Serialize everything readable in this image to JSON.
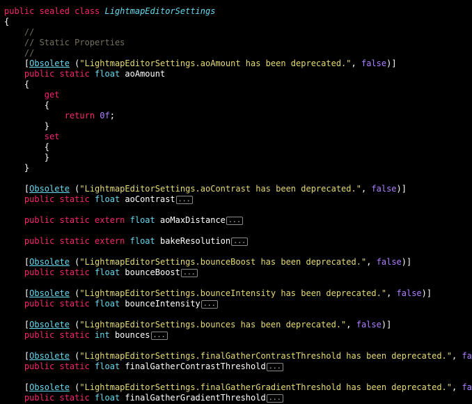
{
  "colors": {
    "background": "#000000",
    "keyword": "#f92672",
    "type": "#66d9ef",
    "string": "#e6db74",
    "number": "#ae81ff",
    "comment": "#75715e",
    "plain": "#ffffff"
  },
  "lines": [
    {
      "tokens": [
        [
          "kw",
          "public sealed class "
        ],
        [
          "ty-i",
          "LightmapEditorSettings"
        ]
      ]
    },
    {
      "tokens": [
        [
          "plain",
          "{"
        ]
      ]
    },
    {
      "tokens": [
        [
          "cm",
          "    //"
        ]
      ]
    },
    {
      "tokens": [
        [
          "cm",
          "    // Static Properties"
        ]
      ]
    },
    {
      "tokens": [
        [
          "cm",
          "    //"
        ]
      ]
    },
    {
      "tokens": [
        [
          "plain",
          "    ["
        ],
        [
          "attr",
          "Obsolete"
        ],
        [
          "plain",
          " ("
        ],
        [
          "str",
          "\"LightmapEditorSettings.aoAmount has been deprecated.\""
        ],
        [
          "plain",
          ", "
        ],
        [
          "num",
          "false"
        ],
        [
          "plain",
          ")]"
        ]
      ]
    },
    {
      "tokens": [
        [
          "kw",
          "    public static "
        ],
        [
          "ty",
          "float"
        ],
        [
          "plain",
          " aoAmount"
        ]
      ]
    },
    {
      "tokens": [
        [
          "plain",
          "    {"
        ]
      ]
    },
    {
      "tokens": [
        [
          "kw",
          "        get"
        ]
      ]
    },
    {
      "tokens": [
        [
          "plain",
          "        {"
        ]
      ]
    },
    {
      "tokens": [
        [
          "kw",
          "            return "
        ],
        [
          "num",
          "0f"
        ],
        [
          "plain",
          ";"
        ]
      ]
    },
    {
      "tokens": [
        [
          "plain",
          "        }"
        ]
      ]
    },
    {
      "tokens": [
        [
          "kw",
          "        set"
        ]
      ]
    },
    {
      "tokens": [
        [
          "plain",
          "        {"
        ]
      ]
    },
    {
      "tokens": [
        [
          "plain",
          "        }"
        ]
      ]
    },
    {
      "tokens": [
        [
          "plain",
          "    }"
        ]
      ]
    },
    {
      "tokens": []
    },
    {
      "tokens": [
        [
          "plain",
          "    ["
        ],
        [
          "attr",
          "Obsolete"
        ],
        [
          "plain",
          " ("
        ],
        [
          "str",
          "\"LightmapEditorSettings.aoContrast has been deprecated.\""
        ],
        [
          "plain",
          ", "
        ],
        [
          "num",
          "false"
        ],
        [
          "plain",
          ")]"
        ]
      ]
    },
    {
      "tokens": [
        [
          "kw",
          "    public static "
        ],
        [
          "ty",
          "float"
        ],
        [
          "plain",
          " aoContrast"
        ],
        [
          "fold",
          "..."
        ]
      ]
    },
    {
      "tokens": []
    },
    {
      "tokens": [
        [
          "kw",
          "    public static extern "
        ],
        [
          "ty",
          "float"
        ],
        [
          "plain",
          " aoMaxDistance"
        ],
        [
          "fold",
          "..."
        ]
      ]
    },
    {
      "tokens": []
    },
    {
      "tokens": [
        [
          "kw",
          "    public static extern "
        ],
        [
          "ty",
          "float"
        ],
        [
          "plain",
          " bakeResolution"
        ],
        [
          "fold",
          "..."
        ]
      ]
    },
    {
      "tokens": []
    },
    {
      "tokens": [
        [
          "plain",
          "    ["
        ],
        [
          "attr",
          "Obsolete"
        ],
        [
          "plain",
          " ("
        ],
        [
          "str",
          "\"LightmapEditorSettings.bounceBoost has been deprecated.\""
        ],
        [
          "plain",
          ", "
        ],
        [
          "num",
          "false"
        ],
        [
          "plain",
          ")]"
        ]
      ]
    },
    {
      "tokens": [
        [
          "kw",
          "    public static "
        ],
        [
          "ty",
          "float"
        ],
        [
          "plain",
          " bounceBoost"
        ],
        [
          "fold",
          "..."
        ]
      ]
    },
    {
      "tokens": []
    },
    {
      "tokens": [
        [
          "plain",
          "    ["
        ],
        [
          "attr",
          "Obsolete"
        ],
        [
          "plain",
          " ("
        ],
        [
          "str",
          "\"LightmapEditorSettings.bounceIntensity has been deprecated.\""
        ],
        [
          "plain",
          ", "
        ],
        [
          "num",
          "false"
        ],
        [
          "plain",
          ")]"
        ]
      ]
    },
    {
      "tokens": [
        [
          "kw",
          "    public static "
        ],
        [
          "ty",
          "float"
        ],
        [
          "plain",
          " bounceIntensity"
        ],
        [
          "fold",
          "..."
        ]
      ]
    },
    {
      "tokens": []
    },
    {
      "tokens": [
        [
          "plain",
          "    ["
        ],
        [
          "attr",
          "Obsolete"
        ],
        [
          "plain",
          " ("
        ],
        [
          "str",
          "\"LightmapEditorSettings.bounces has been deprecated.\""
        ],
        [
          "plain",
          ", "
        ],
        [
          "num",
          "false"
        ],
        [
          "plain",
          ")]"
        ]
      ]
    },
    {
      "tokens": [
        [
          "kw",
          "    public static "
        ],
        [
          "ty",
          "int"
        ],
        [
          "plain",
          " bounces"
        ],
        [
          "fold",
          "..."
        ]
      ]
    },
    {
      "tokens": []
    },
    {
      "tokens": [
        [
          "plain",
          "    ["
        ],
        [
          "attr",
          "Obsolete"
        ],
        [
          "plain",
          " ("
        ],
        [
          "str",
          "\"LightmapEditorSettings.finalGatherContrastThreshold has been deprecated.\""
        ],
        [
          "plain",
          ", "
        ],
        [
          "num",
          "fa"
        ]
      ]
    },
    {
      "tokens": [
        [
          "kw",
          "    public static "
        ],
        [
          "ty",
          "float"
        ],
        [
          "plain",
          " finalGatherContrastThreshold"
        ],
        [
          "fold",
          "..."
        ]
      ]
    },
    {
      "tokens": []
    },
    {
      "tokens": [
        [
          "plain",
          "    ["
        ],
        [
          "attr",
          "Obsolete"
        ],
        [
          "plain",
          " ("
        ],
        [
          "str",
          "\"LightmapEditorSettings.finalGatherGradientThreshold has been deprecated.\""
        ],
        [
          "plain",
          ", "
        ],
        [
          "num",
          "fa"
        ]
      ]
    },
    {
      "tokens": [
        [
          "kw",
          "    public static "
        ],
        [
          "ty",
          "float"
        ],
        [
          "plain",
          " finalGatherGradientThreshold"
        ],
        [
          "fold",
          "..."
        ]
      ]
    }
  ]
}
